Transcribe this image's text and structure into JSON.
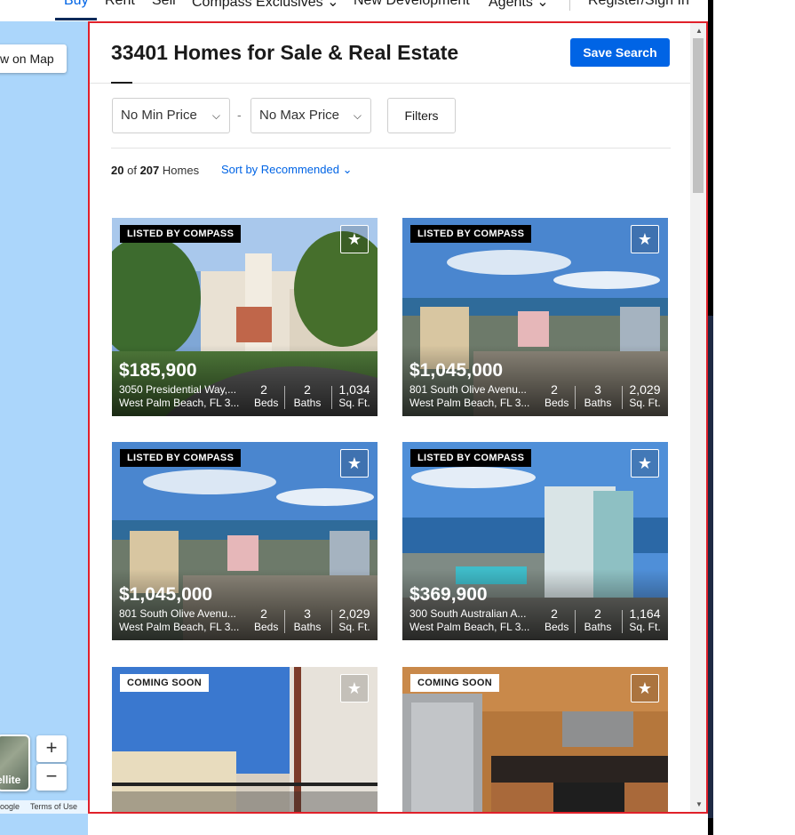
{
  "nav": {
    "items": [
      "Buy",
      "Rent",
      "Sell",
      "Compass Exclusives",
      "New Development",
      "Agents",
      "Register/Sign In"
    ]
  },
  "map": {
    "view_on_map": "w on Map",
    "satellite": "ellite",
    "zoom_in": "+",
    "zoom_out": "−",
    "google": "oogle",
    "terms": "Terms of Use"
  },
  "header": {
    "title": "33401 Homes for Sale & Real Estate",
    "save_search": "Save Search"
  },
  "filters": {
    "min_price": "No Min Price",
    "separator": "-",
    "max_price": "No Max Price",
    "filters_label": "Filters"
  },
  "results": {
    "shown": "20",
    "of": "of",
    "total": "207",
    "unit": "Homes",
    "sort": "Sort by Recommended"
  },
  "listings": [
    {
      "badge": "LISTED BY COMPASS",
      "price": "$185,900",
      "address1": "3050 Presidential Way,...",
      "address2": "West Palm Beach, FL 3...",
      "beds": "2",
      "beds_label": "Beds",
      "baths": "2",
      "baths_label": "Baths",
      "sqft": "1,034",
      "sqft_label": "Sq. Ft."
    },
    {
      "badge": "LISTED BY COMPASS",
      "price": "$1,045,000",
      "address1": "801 South Olive Avenu...",
      "address2": "West Palm Beach, FL 3...",
      "beds": "2",
      "beds_label": "Beds",
      "baths": "3",
      "baths_label": "Baths",
      "sqft": "2,029",
      "sqft_label": "Sq. Ft."
    },
    {
      "badge": "LISTED BY COMPASS",
      "price": "$1,045,000",
      "address1": "801 South Olive Avenu...",
      "address2": "West Palm Beach, FL 3...",
      "beds": "2",
      "beds_label": "Beds",
      "baths": "3",
      "baths_label": "Baths",
      "sqft": "2,029",
      "sqft_label": "Sq. Ft."
    },
    {
      "badge": "LISTED BY COMPASS",
      "price": "$369,900",
      "address1": "300 South Australian A...",
      "address2": "West Palm Beach, FL 3...",
      "beds": "2",
      "beds_label": "Beds",
      "baths": "2",
      "baths_label": "Baths",
      "sqft": "1,164",
      "sqft_label": "Sq. Ft."
    },
    {
      "badge": "COMING SOON"
    },
    {
      "badge": "COMING SOON"
    }
  ],
  "icons": {
    "favorite": "star-icon",
    "chevron": "chevron-down-icon"
  },
  "colors": {
    "accent": "#0064e5",
    "highlight_border": "#e0202a",
    "map_water": "#abd6fb"
  }
}
